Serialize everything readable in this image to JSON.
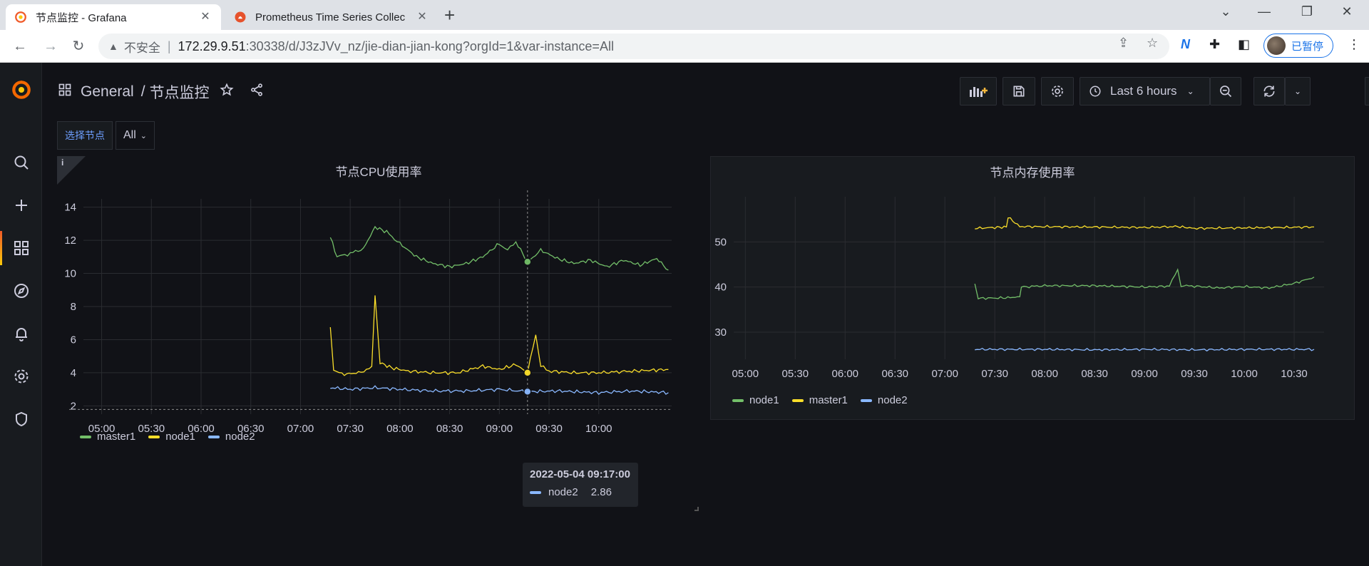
{
  "browser": {
    "tabs": [
      {
        "title": "节点监控 - Grafana",
        "active": true
      },
      {
        "title": "Prometheus Time Series Collec",
        "active": false
      }
    ],
    "omnibox": {
      "security_label": "不安全",
      "host": "172.29.9.51",
      "path": ":30338/d/J3zJVv_nz/jie-dian-jian-kong?orgId=1&var-instance=All"
    },
    "profile_label": "已暂停"
  },
  "navbar": {
    "folder": "General",
    "title": "节点监控",
    "time_range": "Last 6 hours"
  },
  "variables": {
    "label": "选择节点",
    "value": "All"
  },
  "colors": {
    "green": "#73bf69",
    "yellow": "#fade2a",
    "blue": "#8ab8ff"
  },
  "panels": {
    "cpu": {
      "title": "节点CPU使用率",
      "tooltip": {
        "time": "2022-05-04 09:17:00",
        "series": "node2",
        "value": "2.86"
      }
    },
    "mem": {
      "title": "节点内存使用率"
    }
  },
  "chart_data": [
    {
      "type": "line",
      "title": "节点CPU使用率",
      "x_ticks": [
        "05:00",
        "05:30",
        "06:00",
        "06:30",
        "07:00",
        "07:30",
        "08:00",
        "08:30",
        "09:00",
        "09:30",
        "10:00"
      ],
      "y_ticks": [
        2,
        4,
        6,
        8,
        10,
        12,
        14
      ],
      "ylim": [
        1.5,
        14.5
      ],
      "legend": "bottom-left",
      "series": [
        {
          "name": "master1",
          "color": "#73bf69",
          "x": [
            "07:18",
            "07:22",
            "07:30",
            "07:38",
            "07:45",
            "07:52",
            "08:00",
            "08:10",
            "08:20",
            "08:30",
            "08:40",
            "08:50",
            "09:00",
            "09:05",
            "09:10",
            "09:17",
            "09:25",
            "09:35",
            "09:45",
            "09:55",
            "10:05",
            "10:15",
            "10:25",
            "10:35",
            "10:42"
          ],
          "y": [
            12.2,
            11.0,
            11.2,
            11.5,
            12.8,
            12.5,
            11.8,
            11.0,
            10.6,
            10.4,
            10.6,
            11.0,
            11.8,
            11.4,
            11.9,
            10.7,
            11.4,
            10.9,
            10.6,
            10.8,
            10.4,
            10.8,
            10.5,
            10.9,
            10.2
          ]
        },
        {
          "name": "node1",
          "color": "#fade2a",
          "x": [
            "07:18",
            "07:20",
            "07:25",
            "07:35",
            "07:43",
            "07:45",
            "07:48",
            "07:55",
            "08:05",
            "08:20",
            "08:35",
            "08:50",
            "09:00",
            "09:10",
            "09:17",
            "09:22",
            "09:25",
            "09:30",
            "09:45",
            "10:00",
            "10:20",
            "10:42"
          ],
          "y": [
            6.8,
            4.2,
            3.9,
            4.0,
            4.3,
            8.7,
            4.6,
            4.3,
            4.1,
            4.0,
            4.0,
            4.4,
            4.2,
            4.5,
            4.0,
            6.3,
            4.4,
            4.1,
            4.0,
            4.0,
            4.1,
            4.2
          ]
        },
        {
          "name": "node2",
          "color": "#8ab8ff",
          "x": [
            "07:18",
            "07:30",
            "07:45",
            "08:00",
            "08:20",
            "08:40",
            "09:00",
            "09:17",
            "09:35",
            "10:00",
            "10:20",
            "10:42"
          ],
          "y": [
            3.1,
            3.0,
            3.1,
            3.0,
            2.9,
            2.9,
            3.0,
            2.86,
            2.9,
            2.8,
            2.9,
            2.8
          ]
        }
      ]
    },
    {
      "type": "line",
      "title": "节点内存使用率",
      "x_ticks": [
        "05:00",
        "05:30",
        "06:00",
        "06:30",
        "07:00",
        "07:30",
        "08:00",
        "08:30",
        "09:00",
        "09:30",
        "10:00",
        "10:30"
      ],
      "y_ticks": [
        30,
        40,
        50
      ],
      "ylim": [
        24,
        60
      ],
      "legend": "bottom-left",
      "series": [
        {
          "name": "node1",
          "color": "#73bf69",
          "x": [
            "07:18",
            "07:20",
            "07:35",
            "07:45",
            "07:46",
            "08:00",
            "08:30",
            "09:00",
            "09:15",
            "09:20",
            "09:22",
            "09:30",
            "09:45",
            "10:00",
            "10:15",
            "10:30",
            "10:42"
          ],
          "y": [
            40.8,
            37.5,
            37.6,
            37.8,
            40.0,
            40.3,
            40.3,
            40.0,
            40.2,
            44.0,
            40.3,
            40.2,
            39.8,
            40.1,
            39.8,
            40.8,
            42.2
          ]
        },
        {
          "name": "master1",
          "color": "#fade2a",
          "x": [
            "07:18",
            "07:30",
            "07:37",
            "07:38",
            "07:45",
            "08:30",
            "09:00",
            "09:20",
            "09:30",
            "10:00",
            "10:42"
          ],
          "y": [
            53.0,
            53.2,
            53.3,
            55.5,
            53.4,
            53.3,
            53.2,
            53.4,
            53.0,
            53.1,
            53.3
          ]
        },
        {
          "name": "node2",
          "color": "#8ab8ff",
          "x": [
            "07:18",
            "08:00",
            "08:30",
            "09:00",
            "09:30",
            "10:00",
            "10:42"
          ],
          "y": [
            26.2,
            26.2,
            26.1,
            26.2,
            26.1,
            26.2,
            26.2
          ]
        }
      ]
    }
  ]
}
